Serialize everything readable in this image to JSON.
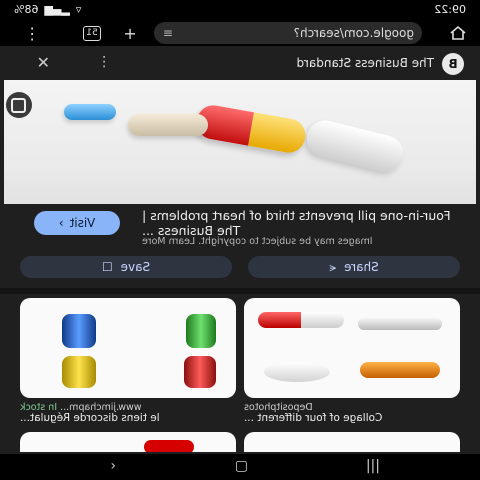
{
  "status_bar": {
    "time": "09:22",
    "battery": "68%"
  },
  "browser": {
    "url": "google.com/search?",
    "tab_count": "51"
  },
  "source": {
    "logo_letter": "B",
    "name": "The Business Standard"
  },
  "result": {
    "title": "Four-in-one pill prevents third of heart problems | The Business ...",
    "copyright_notice": "Images may be subject to copyright. Learn More",
    "visit_label": "Visit",
    "share_label": "Share",
    "save_label": "Save"
  },
  "related": [
    {
      "source": "Depositphotos",
      "title": "Collage of four different ..."
    },
    {
      "source": "www.jimchapm...",
      "stock": "In stock",
      "title": "le tiens discorde Régulat..."
    }
  ],
  "icons": {
    "home": "home-icon",
    "new_tab": "plus-icon",
    "tabs": "tab-count-icon",
    "menu": "kebab-menu-icon",
    "close": "close-icon",
    "lens": "lens-icon",
    "visit": "chevron-right-icon",
    "share": "share-icon",
    "save": "bookmark-icon",
    "back": "back-icon",
    "nav_home": "nav-home-icon",
    "recents": "recents-icon"
  },
  "colors": {
    "accent": "#8ab4f8",
    "background": "#1f1f1f"
  }
}
